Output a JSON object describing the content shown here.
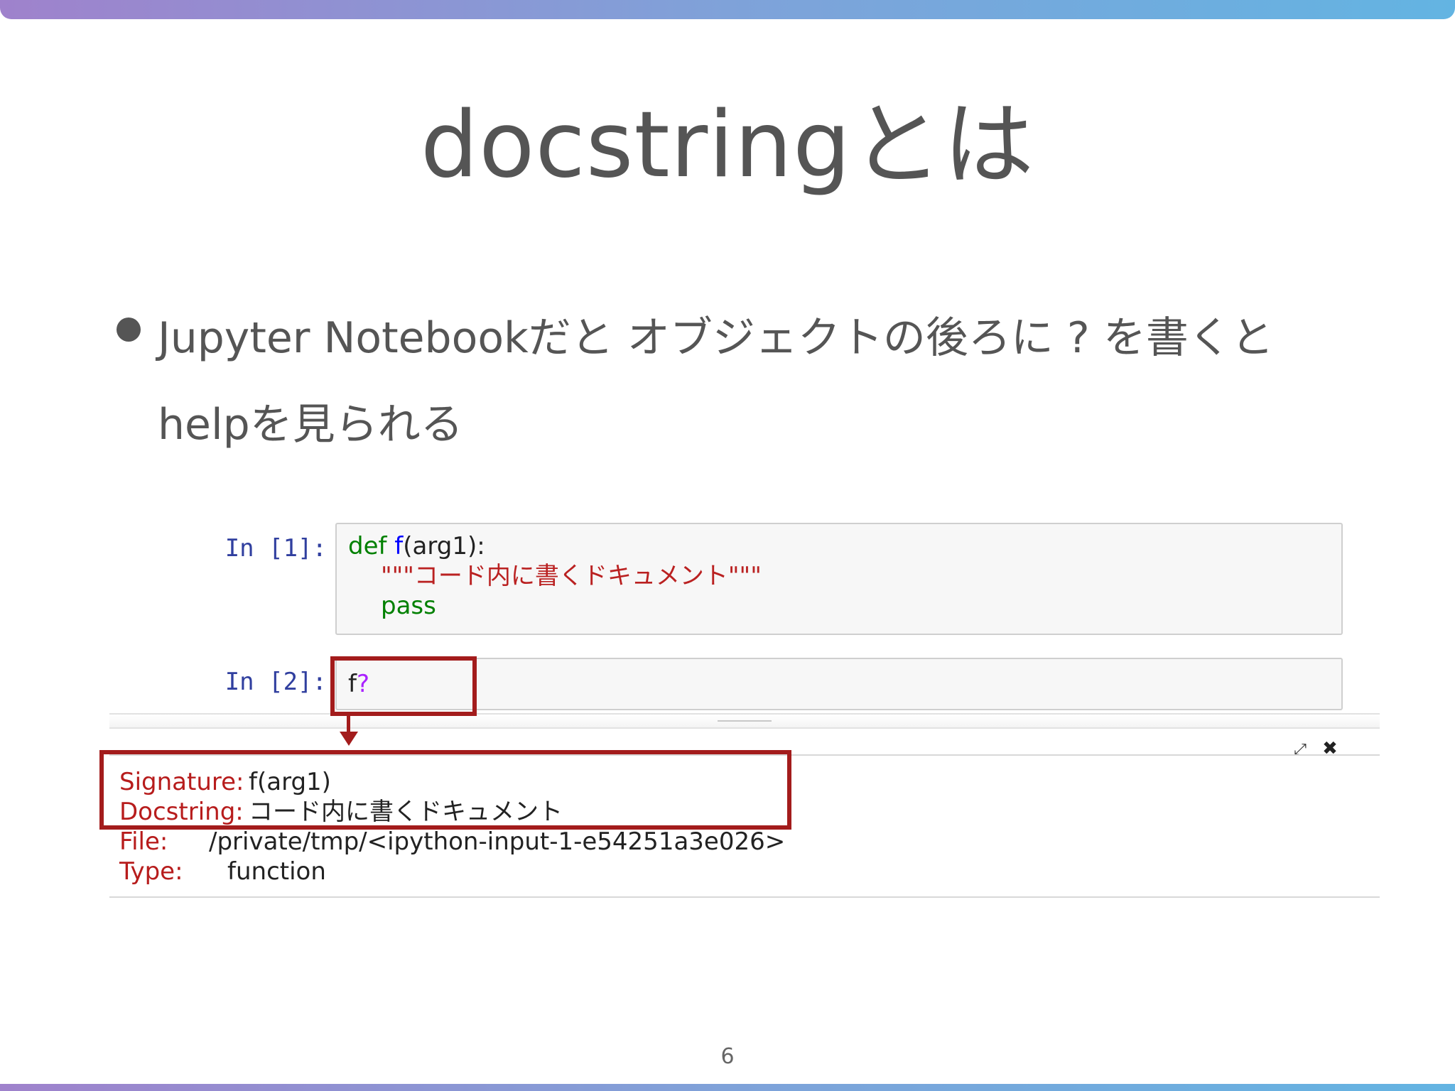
{
  "slide": {
    "title": "docstringとは",
    "bullet": "Jupyter Notebookだと オブジェクトの後ろに ? を書くと helpを見られる",
    "page_number": "6"
  },
  "notebook": {
    "cell1": {
      "prompt": "In [1]:",
      "def_kw": "def",
      "func_name": "f",
      "params": "(arg1):",
      "docstring": "\"\"\"コード内に書くドキュメント\"\"\"",
      "pass_kw": "pass"
    },
    "cell2": {
      "prompt": "In [2]:",
      "name": "f",
      "op": "?"
    },
    "pager": {
      "popout_glyph": "⤢",
      "close_glyph": "✖",
      "signature_key": "Signature:",
      "signature_val": "f(arg1)",
      "docstring_key": "Docstring:",
      "docstring_val": "コード内に書くドキュメント",
      "file_key": "File:",
      "file_val": "/private/tmp/<ipython-input-1-e54251a3e026>",
      "type_key": "Type:",
      "type_val": "function"
    }
  },
  "colors": {
    "accent_gradient_start": "#9f82cc",
    "accent_gradient_end": "#63b4e2",
    "highlight": "#a31c1c",
    "prompt": "#303f9f",
    "keyword": "#008000",
    "string": "#ba2121"
  },
  "icons": [
    "popout-icon",
    "close-icon",
    "arrow-down-icon"
  ]
}
